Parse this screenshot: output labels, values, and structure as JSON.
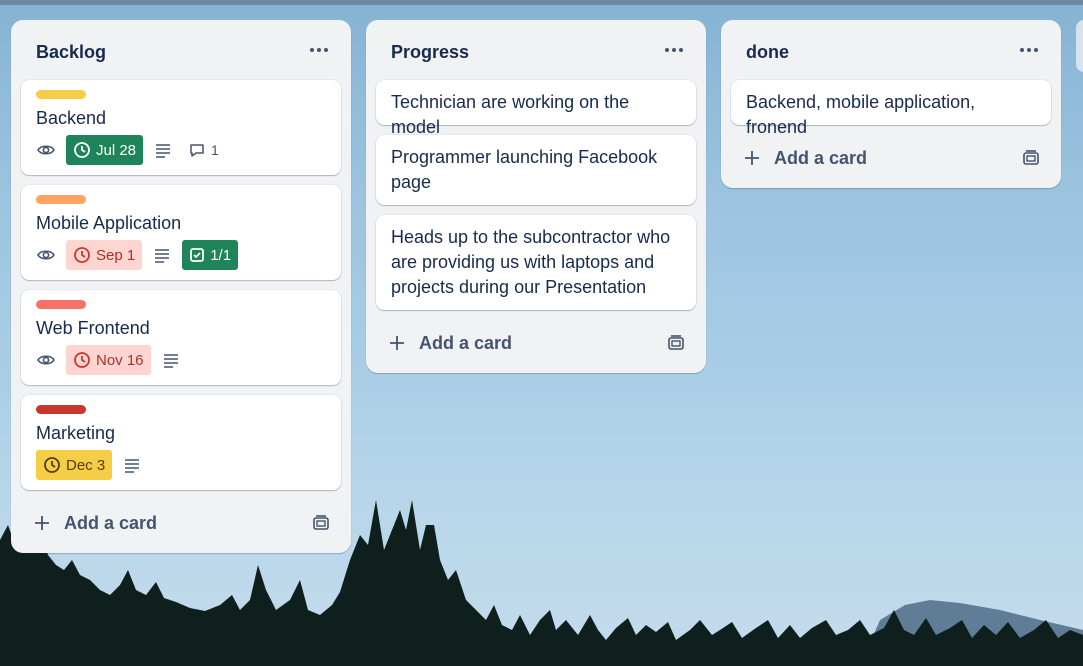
{
  "board": {
    "lists": [
      {
        "title": "Backlog",
        "cards": [
          {
            "title": "Backend",
            "label_color": "#f5cd47",
            "date": "Jul 28",
            "date_status": "complete",
            "comments": "1"
          },
          {
            "title": "Mobile Application",
            "label_color": "#fea362",
            "date": "Sep 1",
            "date_status": "overdue",
            "checklist": "1/1"
          },
          {
            "title": "Web Frontend",
            "label_color": "#f87168",
            "date": "Nov 16",
            "date_status": "overdue"
          },
          {
            "title": "Marketing",
            "label_color": "#c9372c",
            "date": "Dec 3",
            "date_status": "due-soon"
          }
        ],
        "add_card": "Add a card"
      },
      {
        "title": "Progress",
        "cards": [
          {
            "title": "Technician are working on the model"
          },
          {
            "title": "Programmer launching Facebook page"
          },
          {
            "title": "Heads up to the subcontractor who are providing us with laptops and projects during our Presentation"
          }
        ],
        "add_card": "Add a card"
      },
      {
        "title": "done",
        "cards": [
          {
            "title": "Backend, mobile application, fronend"
          }
        ],
        "add_card": "Add a card"
      }
    ]
  },
  "icons": {
    "list_menu": "more-horizontal-icon",
    "watch": "eye-icon",
    "date": "clock-icon",
    "description": "description-lines-icon",
    "comment": "comment-icon",
    "checklist": "checkbox-icon",
    "add": "plus-icon",
    "template": "card-template-icon"
  },
  "colors": {
    "list_bg": "#f1f2f4",
    "date_complete": "#1f845a",
    "date_overdue_bg": "#ffd5d2",
    "date_due_soon": "#f5cd47"
  }
}
